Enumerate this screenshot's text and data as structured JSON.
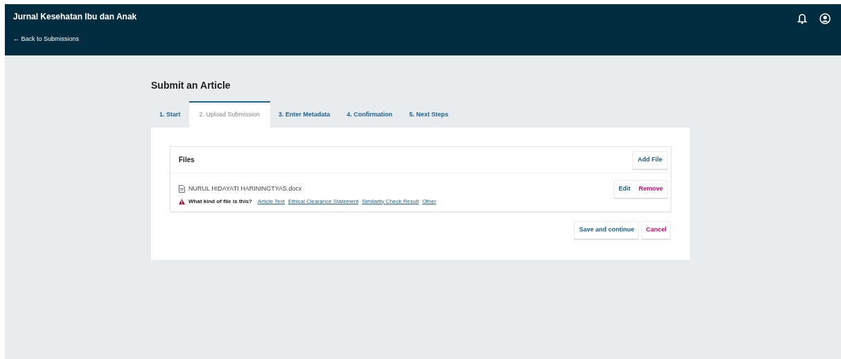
{
  "header": {
    "title": "Jurnal Kesehatan Ibu dan Anak",
    "back_link": "← Back to Submissions"
  },
  "page_title": "Submit an Article",
  "tabs": [
    {
      "label": "1. Start",
      "selected": false
    },
    {
      "label": "2. Upload Submission",
      "selected": true
    },
    {
      "label": "3. Enter Metadata",
      "selected": false
    },
    {
      "label": "4. Confirmation",
      "selected": false
    },
    {
      "label": "5. Next Steps",
      "selected": false
    }
  ],
  "files": {
    "title": "Files",
    "add_button": "Add File",
    "items": [
      {
        "name": "NURUL HIDAYATI HARININGTYAS.docx",
        "edit": "Edit",
        "remove": "Remove",
        "question": "What kind of file is this?",
        "genres": [
          "Article Text",
          "Ethical Clearance Statement",
          "Similarity Check Result",
          "Other"
        ]
      }
    ]
  },
  "actions": {
    "save": "Save and continue",
    "cancel": "Cancel"
  }
}
